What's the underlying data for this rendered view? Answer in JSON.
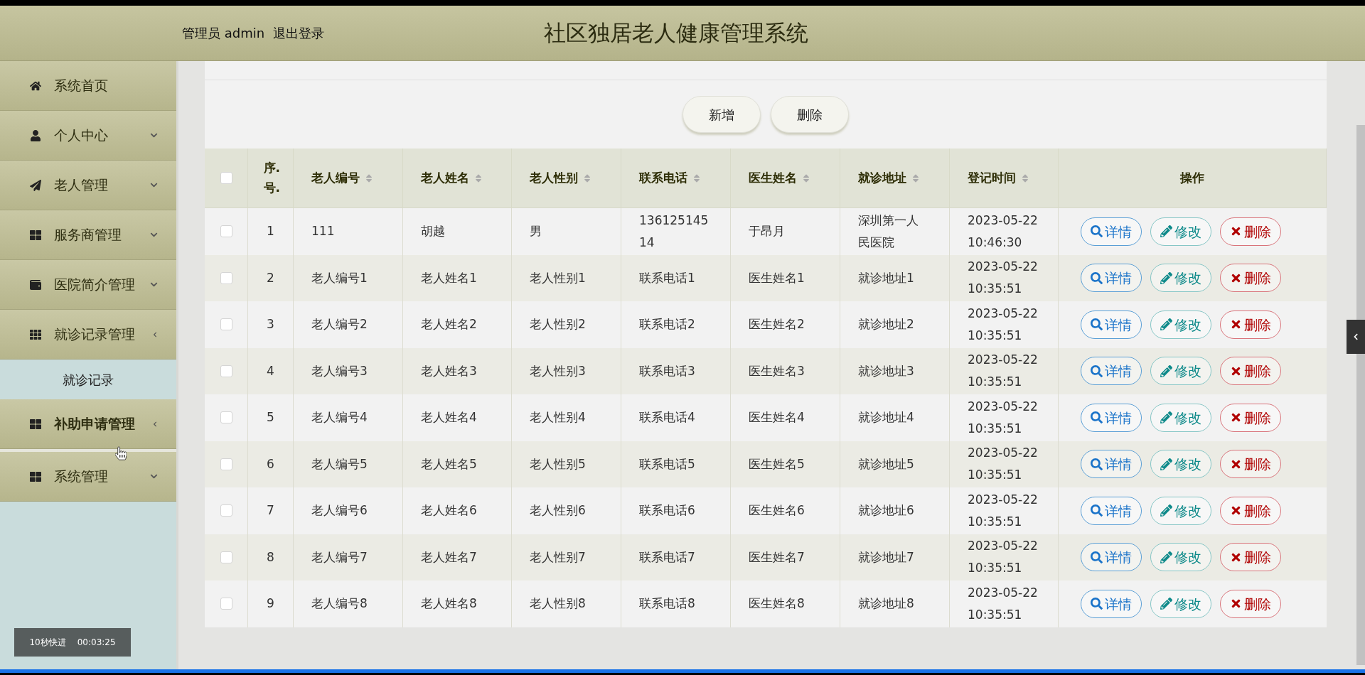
{
  "header": {
    "user_label": "管理员 admin",
    "logout": "退出登录",
    "title": "社区独居老人健康管理系统"
  },
  "sidebar": {
    "items": [
      {
        "label": "系统首页",
        "has_arrow": false,
        "highlighted": false
      },
      {
        "label": "个人中心",
        "has_arrow": true,
        "expanded": false,
        "highlighted": false
      },
      {
        "label": "老人管理",
        "has_arrow": true,
        "expanded": false,
        "highlighted": false
      },
      {
        "label": "服务商管理",
        "has_arrow": true,
        "expanded": false,
        "highlighted": false
      },
      {
        "label": "医院简介管理",
        "has_arrow": true,
        "expanded": false,
        "highlighted": false
      },
      {
        "label": "就诊记录管理",
        "has_arrow": true,
        "expanded": true,
        "highlighted": false,
        "children": [
          {
            "label": "就诊记录"
          }
        ]
      },
      {
        "label": "补助申请管理",
        "has_arrow": true,
        "expanded": true,
        "highlighted": true
      },
      {
        "label": "系统管理",
        "has_arrow": true,
        "expanded": false,
        "highlighted": false
      }
    ]
  },
  "toolbar": {
    "buttons": [
      "新增",
      "删除"
    ]
  },
  "table": {
    "select_all": {
      "checked": false
    },
    "columns": [
      {
        "label": "序.号.",
        "sortable": false
      },
      {
        "label": "老人编号",
        "sortable": true
      },
      {
        "label": "老人姓名",
        "sortable": true
      },
      {
        "label": "老人性别",
        "sortable": true
      },
      {
        "label": "联系电话",
        "sortable": true
      },
      {
        "label": "医生姓名",
        "sortable": true
      },
      {
        "label": "就诊地址",
        "sortable": true
      },
      {
        "label": "登记时间",
        "sortable": true
      },
      {
        "label": "操作",
        "sortable": false
      }
    ],
    "rows": [
      {
        "checked": false,
        "cells": [
          "1",
          "111",
          "胡越",
          "男",
          "13612514514",
          "于昂月",
          "深圳第一人民医院",
          "2023-05-22 10:46:30"
        ],
        "actions": [
          "详情",
          "修改",
          "删除"
        ]
      },
      {
        "checked": false,
        "cells": [
          "2",
          "老人编号1",
          "老人姓名1",
          "老人性别1",
          "联系电话1",
          "医生姓名1",
          "就诊地址1",
          "2023-05-22 10:35:51"
        ],
        "actions": [
          "详情",
          "修改",
          "删除"
        ]
      },
      {
        "checked": false,
        "cells": [
          "3",
          "老人编号2",
          "老人姓名2",
          "老人性别2",
          "联系电话2",
          "医生姓名2",
          "就诊地址2",
          "2023-05-22 10:35:51"
        ],
        "actions": [
          "详情",
          "修改",
          "删除"
        ]
      },
      {
        "checked": false,
        "cells": [
          "4",
          "老人编号3",
          "老人姓名3",
          "老人性别3",
          "联系电话3",
          "医生姓名3",
          "就诊地址3",
          "2023-05-22 10:35:51"
        ],
        "actions": [
          "详情",
          "修改",
          "删除"
        ]
      },
      {
        "checked": false,
        "cells": [
          "5",
          "老人编号4",
          "老人姓名4",
          "老人性别4",
          "联系电话4",
          "医生姓名4",
          "就诊地址4",
          "2023-05-22 10:35:51"
        ],
        "actions": [
          "详情",
          "修改",
          "删除"
        ]
      },
      {
        "checked": false,
        "cells": [
          "6",
          "老人编号5",
          "老人姓名5",
          "老人性别5",
          "联系电话5",
          "医生姓名5",
          "就诊地址5",
          "2023-05-22 10:35:51"
        ],
        "actions": [
          "详情",
          "修改",
          "删除"
        ]
      },
      {
        "checked": false,
        "cells": [
          "7",
          "老人编号6",
          "老人姓名6",
          "老人性别6",
          "联系电话6",
          "医生姓名6",
          "就诊地址6",
          "2023-05-22 10:35:51"
        ],
        "actions": [
          "详情",
          "修改",
          "删除"
        ]
      },
      {
        "checked": false,
        "cells": [
          "8",
          "老人编号7",
          "老人姓名7",
          "老人性别7",
          "联系电话7",
          "医生姓名7",
          "就诊地址7",
          "2023-05-22 10:35:51"
        ],
        "actions": [
          "详情",
          "修改",
          "删除"
        ]
      },
      {
        "checked": false,
        "cells": [
          "9",
          "老人编号8",
          "老人姓名8",
          "老人性别8",
          "联系电话8",
          "医生姓名8",
          "就诊地址8",
          "2023-05-22 10:35:51"
        ],
        "actions": [
          "详情",
          "修改",
          "删除"
        ]
      }
    ]
  },
  "video_overlay": {
    "label": "10秒快进",
    "time": "00:03:25"
  }
}
